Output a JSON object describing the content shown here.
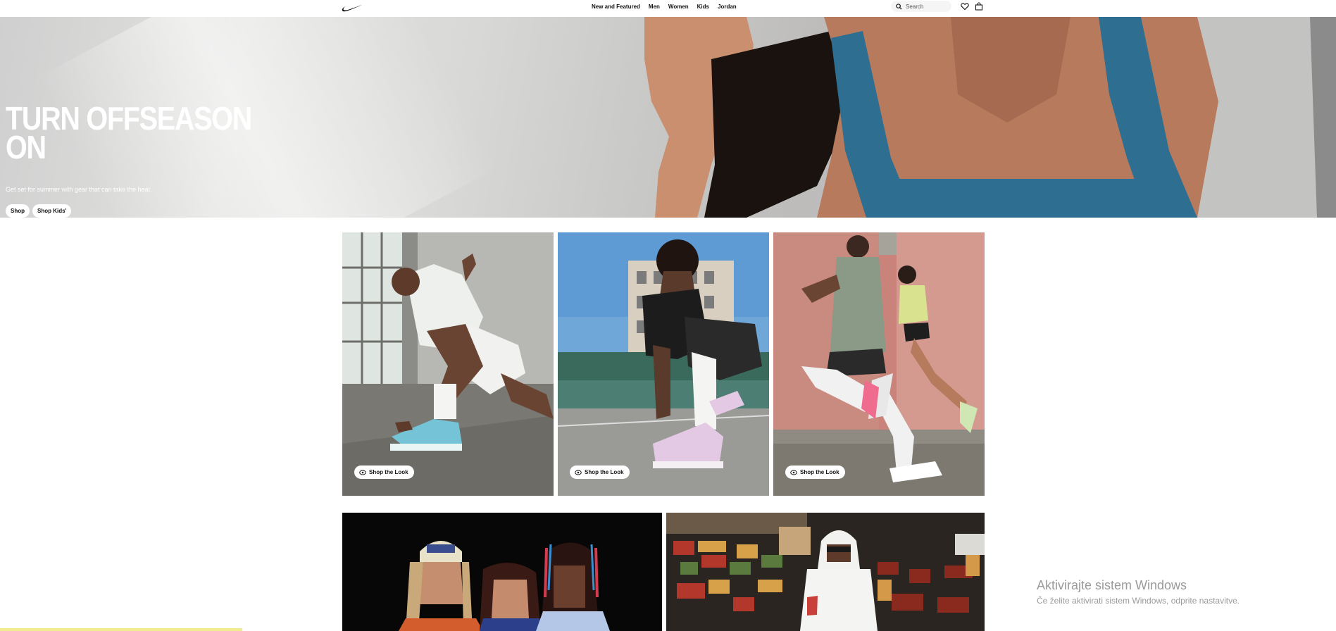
{
  "nav": {
    "search_placeholder": "Search",
    "links": [
      "New and Featured",
      "Men",
      "Women",
      "Kids",
      "Jordan"
    ],
    "icons": [
      "nike-swoosh-logo",
      "search-icon",
      "heart-icon",
      "bag-icon"
    ]
  },
  "hero": {
    "title": "TURN OFFSEASON ON",
    "subtitle": "Get set for summer with gear that can take the heat.",
    "buttons": [
      "Shop",
      "Shop Kids'"
    ]
  },
  "cards": [
    {
      "button": "Shop the Look"
    },
    {
      "button": "Shop the Look"
    },
    {
      "button": "Shop the Look"
    }
  ],
  "watermark": {
    "title": "Aktivirajte sistem Windows",
    "subtitle": "Če želite aktivirati sistem Windows, odprite nastavitve."
  },
  "colors": {
    "accent": "#111111",
    "background": "#ffffff",
    "sports_top": "#2e6f91",
    "bottom_strip": "#f1ea8e"
  }
}
